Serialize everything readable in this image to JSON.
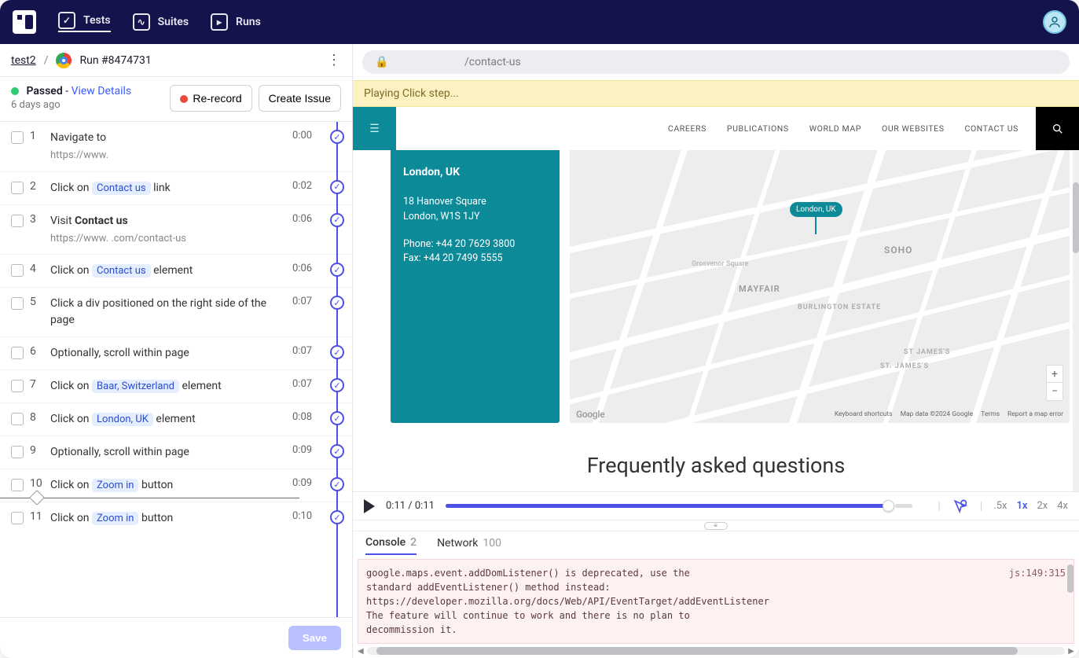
{
  "nav": {
    "tests": "Tests",
    "suites": "Suites",
    "runs": "Runs"
  },
  "breadcrumb": {
    "test_name": "test2",
    "run_label": "Run #8474731"
  },
  "status": {
    "state": "Passed",
    "view_details": "View Details",
    "age": "6 days ago",
    "rerecord": "Re-record",
    "create_issue": "Create Issue"
  },
  "steps": [
    {
      "index": "1",
      "time": "0:00",
      "text_pre": "Navigate to",
      "pill": null,
      "text_post": "",
      "sub": "https://www."
    },
    {
      "index": "2",
      "time": "0:02",
      "text_pre": "Click on",
      "pill": "Contact us",
      "text_post": " link",
      "sub": null
    },
    {
      "index": "3",
      "time": "0:06",
      "text_pre": "Visit ",
      "bold": "Contact us",
      "text_post": "",
      "sub": "https://www.                 .com/contact-us"
    },
    {
      "index": "4",
      "time": "0:06",
      "text_pre": "Click on",
      "pill": "Contact us",
      "text_post": " element",
      "sub": null
    },
    {
      "index": "5",
      "time": "0:07",
      "text_pre": "Click a div positioned on the right side of the page",
      "pill": null,
      "text_post": "",
      "sub": null
    },
    {
      "index": "6",
      "time": "0:07",
      "text_pre": "Optionally, scroll within page",
      "pill": null,
      "text_post": "",
      "sub": null
    },
    {
      "index": "7",
      "time": "0:07",
      "text_pre": "Click on",
      "pill": "Baar, Switzerland",
      "text_post": " element",
      "sub": null
    },
    {
      "index": "8",
      "time": "0:08",
      "text_pre": "Click on",
      "pill": "London, UK",
      "text_post": " element",
      "sub": null
    },
    {
      "index": "9",
      "time": "0:09",
      "text_pre": "Optionally, scroll within page",
      "pill": null,
      "text_post": "",
      "sub": null
    },
    {
      "index": "10",
      "time": "0:09",
      "text_pre": "Click on",
      "pill": "Zoom in",
      "text_post": " button",
      "sub": null
    },
    {
      "index": "11",
      "time": "0:10",
      "text_pre": "Click on",
      "pill": "Zoom in",
      "text_post": " button",
      "sub": null
    }
  ],
  "left_footer": {
    "save": "Save"
  },
  "url_bar": {
    "path": "/contact-us"
  },
  "banner": "Playing Click step...",
  "site": {
    "nav": [
      "CAREERS",
      "PUBLICATIONS",
      "WORLD MAP",
      "OUR WEBSITES",
      "CONTACT US"
    ],
    "panel": {
      "city": "London, UK",
      "addr1": "18 Hanover Square",
      "addr2": "London, W1S 1JY",
      "phone": "Phone: +44 20 7629 3800",
      "fax": "Fax: +44 20 7499 5555"
    },
    "map": {
      "pin": "London, UK",
      "labels": {
        "soho": "SOHO",
        "mayfair": "MAYFAIR",
        "burlington": "BURLINGTON ESTATE",
        "stjames": "ST. JAMES'S",
        "stjames2": "ST JAMES'S",
        "grosvenor": "Grosvenor Square"
      },
      "footer": {
        "google": "Google",
        "kb": "Keyboard shortcuts",
        "data": "Map data ©2024 Google",
        "terms": "Terms",
        "report": "Report a map error"
      }
    },
    "faq": "Frequently asked questions"
  },
  "player": {
    "time": "0:11 / 0:11",
    "speeds": [
      ".5x",
      "1x",
      "2x",
      "4x"
    ],
    "active_speed": "1x"
  },
  "console": {
    "tabs": [
      {
        "label": "Console",
        "count": "2"
      },
      {
        "label": "Network",
        "count": "100"
      }
    ],
    "message": "google.maps.event.addDomListener() is deprecated, use the standard addEventListener() method instead: https://developer.mozilla.org/docs/Web/API/EventTarget/addEventListener\nThe feature will continue to work and there is no plan to decommission it.",
    "source": "js:149:315"
  }
}
